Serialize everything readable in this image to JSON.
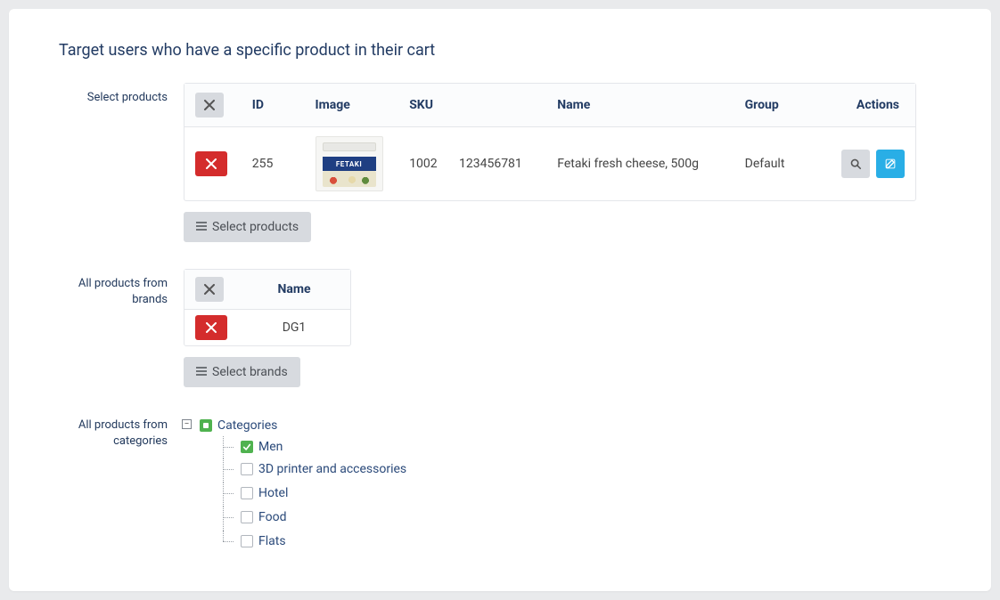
{
  "page": {
    "title": "Target users who have a specific product in their cart"
  },
  "labels": {
    "select_products": "Select products",
    "all_brands": "All products from brands",
    "all_categories": "All products from categories"
  },
  "products_table": {
    "headers": {
      "id": "ID",
      "image": "Image",
      "sku": "SKU",
      "name": "Name",
      "group": "Group",
      "actions": "Actions"
    },
    "rows": [
      {
        "id": "255",
        "sku": "1002",
        "barcode": "123456781",
        "name": "Fetaki fresh cheese, 500g",
        "group": "Default",
        "image_brand_text": "FETAKI"
      }
    ],
    "select_button": "Select products"
  },
  "brands_table": {
    "headers": {
      "name": "Name"
    },
    "rows": [
      {
        "name": "DG1"
      }
    ],
    "select_button": "Select brands"
  },
  "categories_tree": {
    "root": "Categories",
    "root_state": "partial",
    "children": [
      {
        "label": "Men",
        "checked": true
      },
      {
        "label": "3D printer and accessories",
        "checked": false
      },
      {
        "label": "Hotel",
        "checked": false
      },
      {
        "label": "Food",
        "checked": false
      },
      {
        "label": "Flats",
        "checked": false
      }
    ]
  }
}
